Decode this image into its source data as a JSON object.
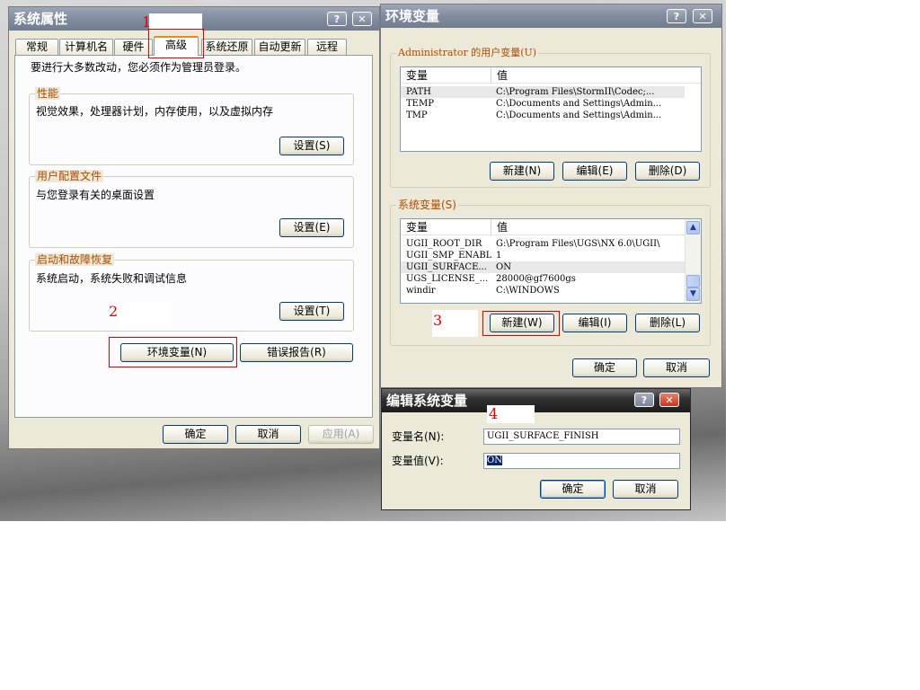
{
  "sysprops": {
    "title": "系统属性",
    "help_btn": "?",
    "close_btn": "✕",
    "tabs": [
      "常规",
      "计算机名",
      "硬件",
      "高级",
      "系统还原",
      "自动更新",
      "远程"
    ],
    "admin_note": "要进行大多数改动，您必须作为管理员登录。",
    "perf": {
      "legend": "性能",
      "desc": "视觉效果，处理器计划，内存使用，以及虚拟内存",
      "button": "设置(S)"
    },
    "profile": {
      "legend": "用户配置文件",
      "desc": "与您登录有关的桌面设置",
      "button": "设置(E)"
    },
    "startup": {
      "legend": "启动和故障恢复",
      "desc": "系统启动，系统失败和调试信息",
      "button": "设置(T)"
    },
    "env_button": "环境变量(N)",
    "error_button": "错误报告(R)",
    "ok": "确定",
    "cancel": "取消",
    "apply": "应用(A)"
  },
  "envvars": {
    "title": "环境变量",
    "help_btn": "?",
    "close_btn": "✕",
    "user_group": "Administrator 的用户变量(U)",
    "col_var": "变量",
    "col_val": "值",
    "user_vars": [
      {
        "name": "PATH",
        "value": "C:\\Program Files\\StormII\\Codec;..."
      },
      {
        "name": "TEMP",
        "value": "C:\\Documents and Settings\\Admin..."
      },
      {
        "name": "TMP",
        "value": "C:\\Documents and Settings\\Admin..."
      }
    ],
    "user_new": "新建(N)",
    "user_edit": "编辑(E)",
    "user_delete": "删除(D)",
    "sys_group": "系统变量(S)",
    "sys_vars": [
      {
        "name": "UGII_ROOT_DIR",
        "value": "G:\\Program Files\\UGS\\NX 6.0\\UGII\\"
      },
      {
        "name": "UGII_SMP_ENABLE",
        "value": "1"
      },
      {
        "name": "UGII_SURFACE...",
        "value": "ON"
      },
      {
        "name": "UGS_LICENSE_...",
        "value": "28000@gf7600gs"
      },
      {
        "name": "windir",
        "value": "C:\\WINDOWS"
      }
    ],
    "sys_new": "新建(W)",
    "sys_edit": "编辑(I)",
    "sys_delete": "删除(L)",
    "ok": "确定",
    "cancel": "取消"
  },
  "editvar": {
    "title": "编辑系统变量",
    "help_btn": "?",
    "close_btn": "✕",
    "name_label": "变量名(N):",
    "name_value": "UGII_SURFACE_FINISH",
    "value_label": "变量值(V):",
    "value_value": "ON",
    "ok": "确定",
    "cancel": "取消"
  },
  "annotations": [
    "1",
    "2",
    "3",
    "4"
  ],
  "colors": {
    "annotation_red": "#e00000",
    "title_active": "#333333",
    "title_inactive": "#828c9f"
  }
}
